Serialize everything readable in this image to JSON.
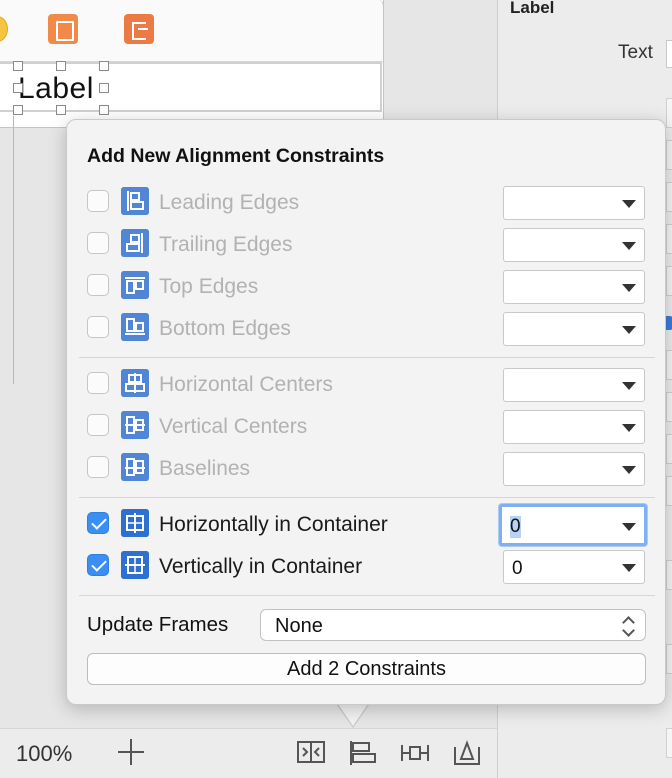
{
  "canvas": {
    "selected_label_text": "Label",
    "zoom_level": "100%"
  },
  "inspector": {
    "title": "Label",
    "text_field_label": "Text"
  },
  "popover": {
    "title": "Add New Alignment Constraints",
    "rows": [
      {
        "label": "Leading Edges",
        "checked": false,
        "enabled": false,
        "value": "",
        "icon": "leading-edges-icon"
      },
      {
        "label": "Trailing Edges",
        "checked": false,
        "enabled": false,
        "value": "",
        "icon": "trailing-edges-icon"
      },
      {
        "label": "Top Edges",
        "checked": false,
        "enabled": false,
        "value": "",
        "icon": "top-edges-icon"
      },
      {
        "label": "Bottom Edges",
        "checked": false,
        "enabled": false,
        "value": "",
        "icon": "bottom-edges-icon"
      },
      {
        "label": "Horizontal Centers",
        "checked": false,
        "enabled": false,
        "value": "",
        "icon": "horizontal-centers-icon"
      },
      {
        "label": "Vertical Centers",
        "checked": false,
        "enabled": false,
        "value": "",
        "icon": "vertical-centers-icon"
      },
      {
        "label": "Baselines",
        "checked": false,
        "enabled": false,
        "value": "",
        "icon": "baselines-icon"
      },
      {
        "label": "Horizontally in Container",
        "checked": true,
        "enabled": true,
        "value": "0",
        "icon": "horizontally-in-container-icon"
      },
      {
        "label": "Vertically in Container",
        "checked": true,
        "enabled": true,
        "value": "0",
        "icon": "vertically-in-container-icon"
      }
    ],
    "update_frames_label": "Update Frames",
    "update_frames_value": "None",
    "add_button_label": "Add 2 Constraints"
  },
  "colors": {
    "accent": "#3a8ff5",
    "icon_blue": "#2e6fd2",
    "focus_ring": "#7fb0ef"
  }
}
